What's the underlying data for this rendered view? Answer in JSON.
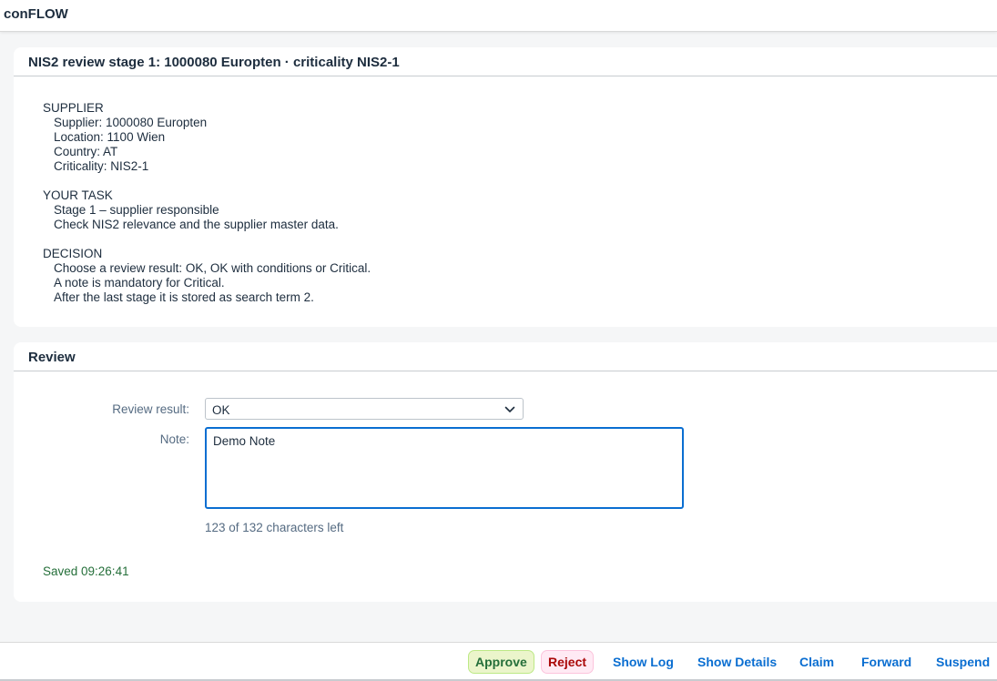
{
  "shell": {
    "title": "conFLOW"
  },
  "task_panel": {
    "title": "NIS2 review stage 1: 1000080 Europten · criticality NIS2-1",
    "sections": [
      {
        "heading": "SUPPLIER",
        "lines": [
          "Supplier: 1000080 Europten",
          "Location: 1100 Wien",
          "Country: AT",
          "Criticality: NIS2-1"
        ]
      },
      {
        "heading": "YOUR TASK",
        "lines": [
          "Stage 1 – supplier responsible",
          "Check NIS2 relevance and the supplier master data."
        ]
      },
      {
        "heading": "DECISION",
        "lines": [
          "Choose a review result: OK, OK with conditions or Critical.",
          "A note is mandatory for Critical.",
          "After the last stage it is stored as search term 2."
        ]
      }
    ]
  },
  "review_panel": {
    "title": "Review",
    "review_result_label": "Review result:",
    "review_result_value": "OK",
    "note_label": "Note:",
    "note_value": "Demo Note",
    "char_counter": "123 of 132 characters left",
    "saved_status": "Saved 09:26:41"
  },
  "footer": {
    "approve": "Approve",
    "reject": "Reject",
    "show_log": "Show Log",
    "show_details": "Show Details",
    "claim": "Claim",
    "forward": "Forward",
    "suspend": "Suspend"
  },
  "colors": {
    "accent": "#0a6ed1",
    "approve_bg": "#ebf5cb",
    "approve_text": "#256f3a",
    "reject_bg": "#ffeaf4",
    "reject_text": "#aa0808",
    "saved_text": "#256f3a"
  },
  "icons": {
    "select_toggle": "chevron-down-icon"
  }
}
